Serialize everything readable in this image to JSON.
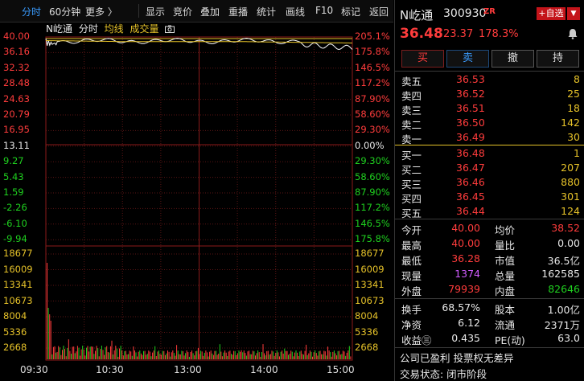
{
  "toolbar": {
    "items": [
      "分时",
      "60分钟",
      "更多 〉",
      "显示",
      "竞价",
      "叠加",
      "重播",
      "统计",
      "画线",
      "F10",
      "标记",
      "返回"
    ]
  },
  "chart": {
    "stock_name": "N屹通",
    "mode": "分时",
    "legend_avg": "均线",
    "legend_vol": "成交量"
  },
  "price_axis": {
    "left": [
      "40.00",
      "36.16",
      "32.32",
      "28.48",
      "24.63",
      "20.79",
      "16.95",
      "13.11",
      "9.27",
      "5.43",
      "1.59",
      "-2.26",
      "-6.10",
      "-9.94"
    ],
    "right": [
      "205.1%",
      "175.8%",
      "146.5%",
      "117.2%",
      "87.90%",
      "58.60%",
      "29.30%",
      "0.00%",
      "29.30%",
      "58.60%",
      "87.90%",
      "117.2%",
      "146.5%",
      "175.8%"
    ]
  },
  "volume_axis": [
    "18677",
    "16009",
    "13341",
    "10673",
    "8004",
    "5336",
    "2668"
  ],
  "time_axis": [
    "09:30",
    "10:30",
    "13:00",
    "14:00",
    "15:00"
  ],
  "colors": {
    "up": "#ff3c3c",
    "down": "#1fd11f",
    "avg": "#e6c229",
    "price_line": "#ffffff",
    "accent": "#3a9cff"
  },
  "quote": {
    "name": "N屹通",
    "code": "300930",
    "tag": "ZR",
    "add_fav": "+自选",
    "price": "36.48",
    "change": "23.37",
    "change_pct": "178.3%",
    "buttons": [
      "买",
      "卖",
      "撤",
      "持"
    ]
  },
  "asks": [
    {
      "label": "卖五",
      "price": "36.53",
      "vol": "8"
    },
    {
      "label": "卖四",
      "price": "36.52",
      "vol": "25"
    },
    {
      "label": "卖三",
      "price": "36.51",
      "vol": "18"
    },
    {
      "label": "卖二",
      "price": "36.50",
      "vol": "142"
    },
    {
      "label": "卖一",
      "price": "36.49",
      "vol": "30"
    }
  ],
  "bids": [
    {
      "label": "买一",
      "price": "36.48",
      "vol": "1"
    },
    {
      "label": "买二",
      "price": "36.47",
      "vol": "207"
    },
    {
      "label": "买三",
      "price": "36.46",
      "vol": "880"
    },
    {
      "label": "买四",
      "price": "36.45",
      "vol": "301"
    },
    {
      "label": "买五",
      "price": "36.44",
      "vol": "124"
    }
  ],
  "stats": {
    "open_l": "今开",
    "open": "40.00",
    "avg_l": "均价",
    "avg": "38.52",
    "high_l": "最高",
    "high": "40.00",
    "ratio_l": "量比",
    "ratio": "0.00",
    "low_l": "最低",
    "low": "36.28",
    "mcap_l": "市值",
    "mcap": "36.5亿",
    "cur_l": "现量",
    "cur": "1374",
    "tot_l": "总量",
    "tot": "162585",
    "outer_l": "外盘",
    "outer": "79939",
    "inner_l": "内盘",
    "inner": "82646"
  },
  "fund": {
    "turn_l": "换手",
    "turn": "68.57%",
    "cap_l": "股本",
    "cap": "1.00亿",
    "nav_l": "净资",
    "nav": "6.12",
    "float_l": "流通",
    "float": "2371万",
    "eps_l": "收益㊂",
    "eps": "0.435",
    "pe_l": "PE(动)",
    "pe": "63.0"
  },
  "notes": {
    "line1": "公司已盈利 投票权无差异",
    "line2": "交易状态: 闭市阶段"
  }
}
